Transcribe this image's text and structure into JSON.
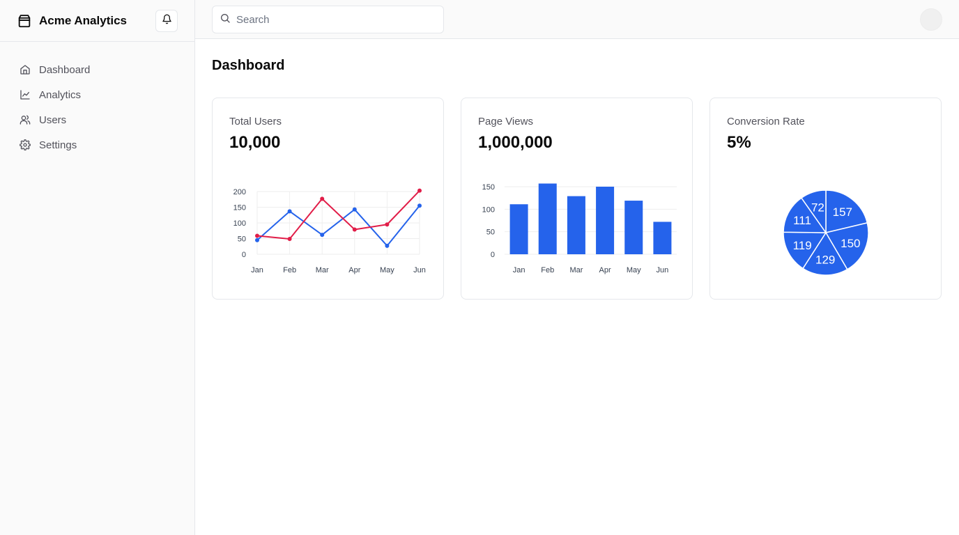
{
  "app": {
    "name": "Acme Analytics"
  },
  "search": {
    "placeholder": "Search",
    "value": ""
  },
  "sidebar": {
    "items": [
      {
        "label": "Dashboard",
        "icon": "home-icon"
      },
      {
        "label": "Analytics",
        "icon": "line-chart-icon"
      },
      {
        "label": "Users",
        "icon": "users-icon"
      },
      {
        "label": "Settings",
        "icon": "gear-icon"
      }
    ]
  },
  "page": {
    "title": "Dashboard"
  },
  "cards": [
    {
      "title": "Total Users",
      "value": "10,000"
    },
    {
      "title": "Page Views",
      "value": "1,000,000"
    },
    {
      "title": "Conversion Rate",
      "value": "5%"
    }
  ],
  "colors": {
    "blue": "#2563eb",
    "red": "#e11d48",
    "grid": "#eeeeee"
  },
  "chart_data": [
    {
      "type": "line",
      "categories": [
        "Jan",
        "Feb",
        "Mar",
        "Apr",
        "May",
        "Jun"
      ],
      "ylim": [
        0,
        200
      ],
      "yticks": [
        0,
        50,
        100,
        150,
        200
      ],
      "grid": true,
      "series": [
        {
          "color": "#2563eb",
          "values": [
            45,
            137,
            62,
            143,
            27,
            155
          ]
        },
        {
          "color": "#e11d48",
          "values": [
            59,
            49,
            177,
            79,
            95,
            203
          ]
        }
      ]
    },
    {
      "type": "bar",
      "categories": [
        "Jan",
        "Feb",
        "Mar",
        "Apr",
        "May",
        "Jun"
      ],
      "values": [
        111,
        157,
        129,
        150,
        119,
        72
      ],
      "ylim": [
        0,
        150
      ],
      "yticks": [
        0,
        50,
        100,
        150
      ],
      "grid": true,
      "color": "#2563eb"
    },
    {
      "type": "pie",
      "values": [
        157,
        150,
        129,
        119,
        111,
        72
      ],
      "labels": [
        "157",
        "150",
        "129",
        "119",
        "111",
        "72"
      ],
      "color": "#2563eb"
    }
  ]
}
